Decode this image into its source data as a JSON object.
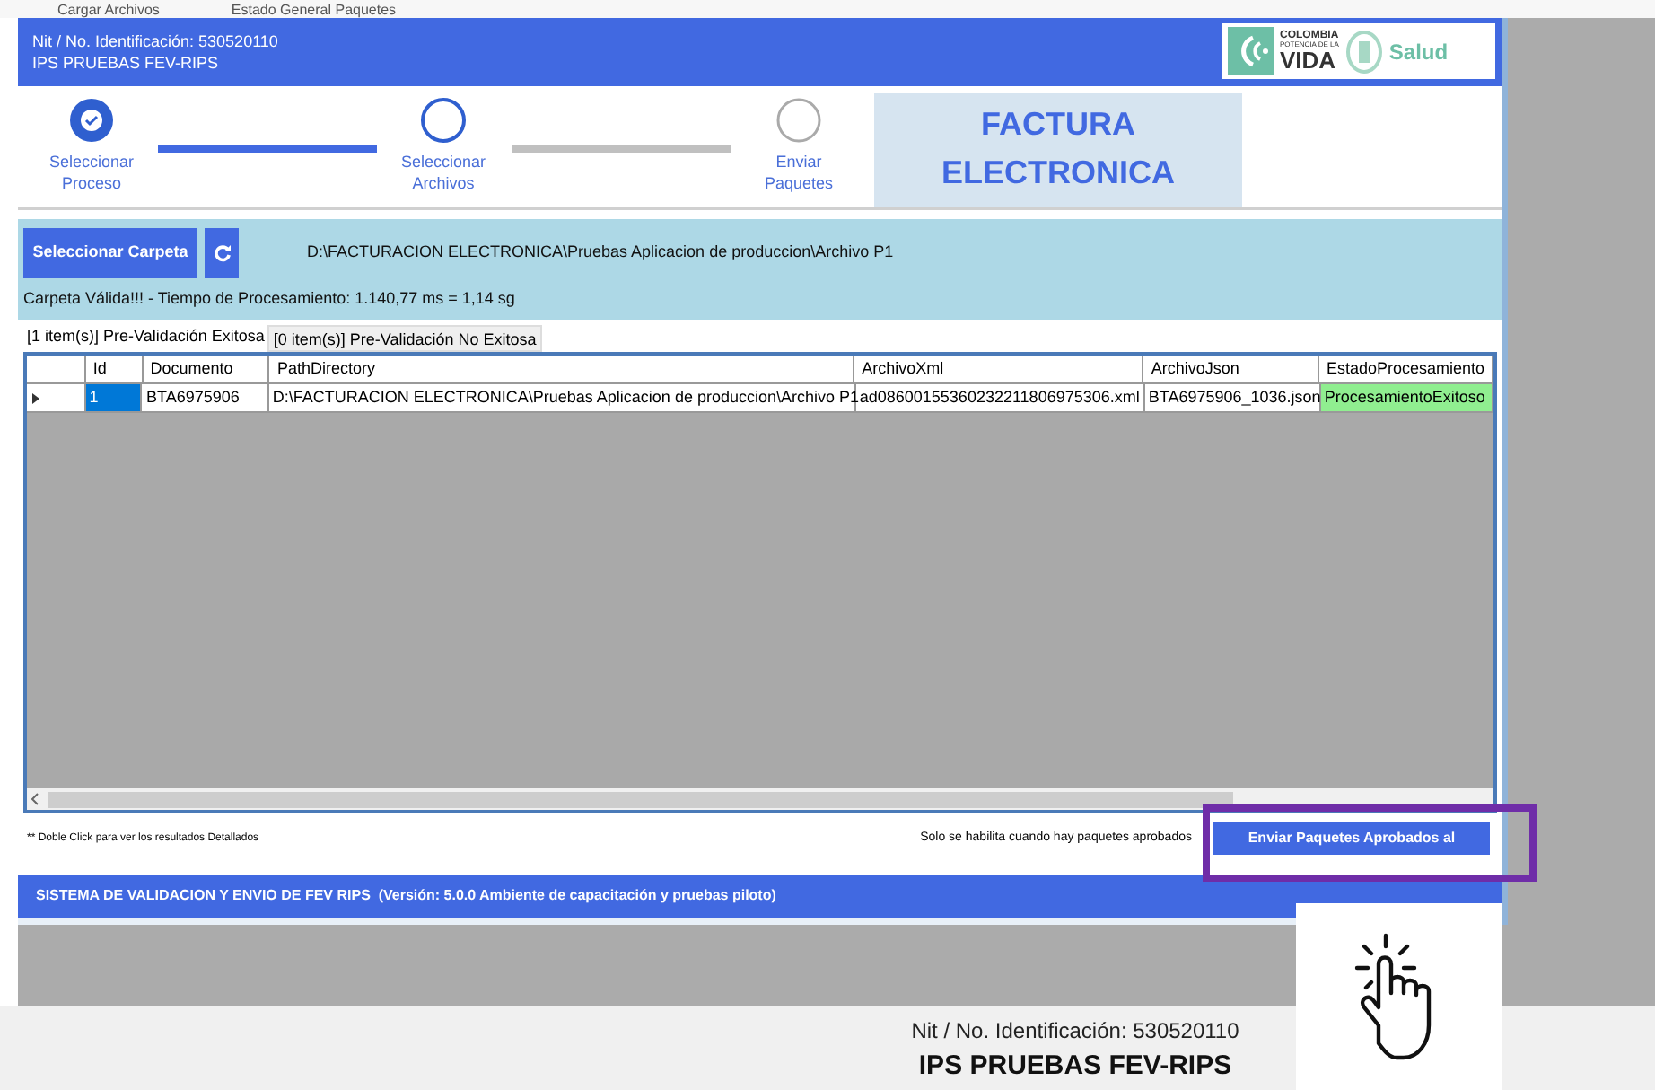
{
  "menu_strip": [
    "Cargar Archivos",
    "Estado General Paquetes"
  ],
  "header": {
    "nit": "Nit / No. Identificación: 530520110",
    "name": "IPS PRUEBAS FEV-RIPS",
    "logo": {
      "line_1": "COLOMBIA",
      "line_2": "POTENCIA DE LA",
      "line_3": "VIDA",
      "brand": "Salud"
    }
  },
  "steps": [
    {
      "label": "Seleccionar Proceso",
      "completed": true
    },
    {
      "label": "Seleccionar Archivos",
      "completed": false,
      "active": true
    },
    {
      "label": "Enviar Paquetes",
      "completed": false,
      "active": false
    }
  ],
  "connectors": [
    {
      "active": true
    },
    {
      "active": false
    }
  ],
  "title_box": "FACTURA ELECTRONICA",
  "folder": {
    "button": "Seleccionar Carpeta",
    "path": "D:\\FACTURACION ELECTRONICA\\Pruebas Aplicacion de produccion\\Archivo P1",
    "message": "Carpeta Válida!!! - Tiempo de Procesamiento: 1.140,77 ms = 1,14 sg"
  },
  "tabs": [
    {
      "label": "[1 item(s)] Pre-Validación Exitosa",
      "selected": true
    },
    {
      "label": "[0 item(s)] Pre-Validación No Exitosa",
      "selected": false
    }
  ],
  "table": {
    "columns": [
      "Id",
      "Documento",
      "PathDirectory",
      "ArchivoXml",
      "ArchivoJson",
      "EstadoProcesamiento"
    ],
    "rows": [
      {
        "selected": true,
        "success": true,
        "cells": [
          "1",
          "BTA6975906",
          "D:\\FACTURACION ELECTRONICA\\Pruebas Aplicacion de produccion\\Archivo P1",
          "ad08600155360232211806975306.xml",
          "BTA6975906_1036.json",
          "ProcesamientoExitoso"
        ]
      }
    ]
  },
  "note": "** Doble Click para ver los resultados Detallados",
  "send_hint": "Solo se habilita cuando hay paquetes aprobados",
  "send_button": "Enviar Paquetes Aprobados al",
  "footer": "SISTEMA DE VALIDACION Y ENVIO DE FEV RIPS  (Versión: 5.0.0 Ambiente de capacitación y pruebas piloto)",
  "bottom": {
    "nit": "Nit / No. Identificación: 530520110",
    "name": "IPS PRUEBAS FEV-RIPS"
  }
}
